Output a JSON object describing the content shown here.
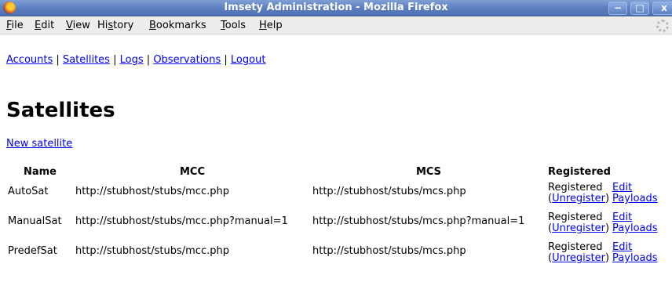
{
  "window": {
    "title": "Imsety Administration - Mozilla Firefox",
    "minimize_glyph": "−",
    "maximize_glyph": "□",
    "close_glyph": "x"
  },
  "menu": {
    "file": "File",
    "edit": "Edit",
    "view": "View",
    "history": "History",
    "bookmarks": "Bookmarks",
    "tools": "Tools",
    "help": "Help"
  },
  "nav": {
    "accounts": "Accounts",
    "satellites": "Satellites",
    "logs": "Logs",
    "observations": "Observations",
    "logout": "Logout",
    "separator": "|"
  },
  "page": {
    "title": "Satellites",
    "new_link": "New satellite"
  },
  "table": {
    "headers": {
      "name": "Name",
      "mcc": "MCC",
      "mcs": "MCS",
      "registered": "Registered"
    },
    "rows": [
      {
        "name": "AutoSat",
        "mcc": "http://stubhost/stubs/mcc.php",
        "mcs": "http://stubhost/stubs/mcs.php",
        "status": "Registered",
        "unregister": "Unregister",
        "edit": "Edit",
        "payloads": "Payloads"
      },
      {
        "name": "ManualSat",
        "mcc": "http://stubhost/stubs/mcc.php?manual=1",
        "mcs": "http://stubhost/stubs/mcs.php?manual=1",
        "status": "Registered",
        "unregister": "Unregister",
        "edit": "Edit",
        "payloads": "Payloads"
      },
      {
        "name": "PredefSat",
        "mcc": "http://stubhost/stubs/mcc.php",
        "mcs": "http://stubhost/stubs/mcs.php",
        "status": "Registered",
        "unregister": "Unregister",
        "edit": "Edit",
        "payloads": "Payloads"
      }
    ]
  },
  "colors": {
    "link": "#0000ee",
    "titlebar": "#5b7dbe",
    "menubar": "#ededed"
  },
  "icons": {
    "app": "firefox-icon",
    "throbber": "throbber-icon"
  }
}
